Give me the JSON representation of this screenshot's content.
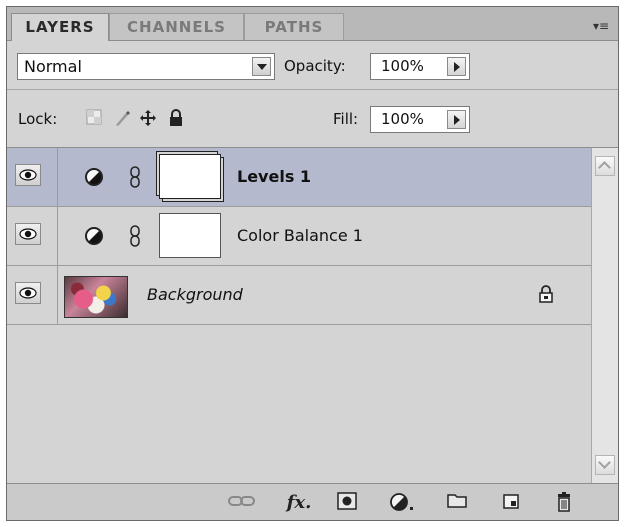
{
  "tabs": [
    {
      "label": "LAYERS",
      "active": true
    },
    {
      "label": "CHANNELS",
      "active": false
    },
    {
      "label": "PATHS",
      "active": false
    }
  ],
  "panel_menu_icon": "panel-menu-icon",
  "blend_mode": {
    "value": "Normal"
  },
  "opacity": {
    "label": "Opacity:",
    "value": "100%"
  },
  "lock": {
    "label": "Lock:",
    "icons": [
      "lock-transparent-pixels-icon",
      "lock-image-pixels-icon",
      "lock-position-icon",
      "lock-all-icon"
    ]
  },
  "fill": {
    "label": "Fill:",
    "value": "100%"
  },
  "layers": [
    {
      "name": "Levels 1",
      "type": "adjustment",
      "selected": true,
      "visible": true
    },
    {
      "name": "Color Balance 1",
      "type": "adjustment",
      "selected": false,
      "visible": true
    },
    {
      "name": "Background",
      "type": "image",
      "selected": false,
      "visible": true,
      "locked": true
    }
  ],
  "footer_icons": [
    "link-layers-icon",
    "fx-icon",
    "add-mask-icon",
    "new-adjustment-layer-icon",
    "new-group-icon",
    "new-layer-icon",
    "delete-layer-icon"
  ],
  "colors": {
    "selected_row": "#b4b9cd",
    "panel_bg": "#d4d4d4",
    "tab_bar": "#b8b8b8"
  }
}
